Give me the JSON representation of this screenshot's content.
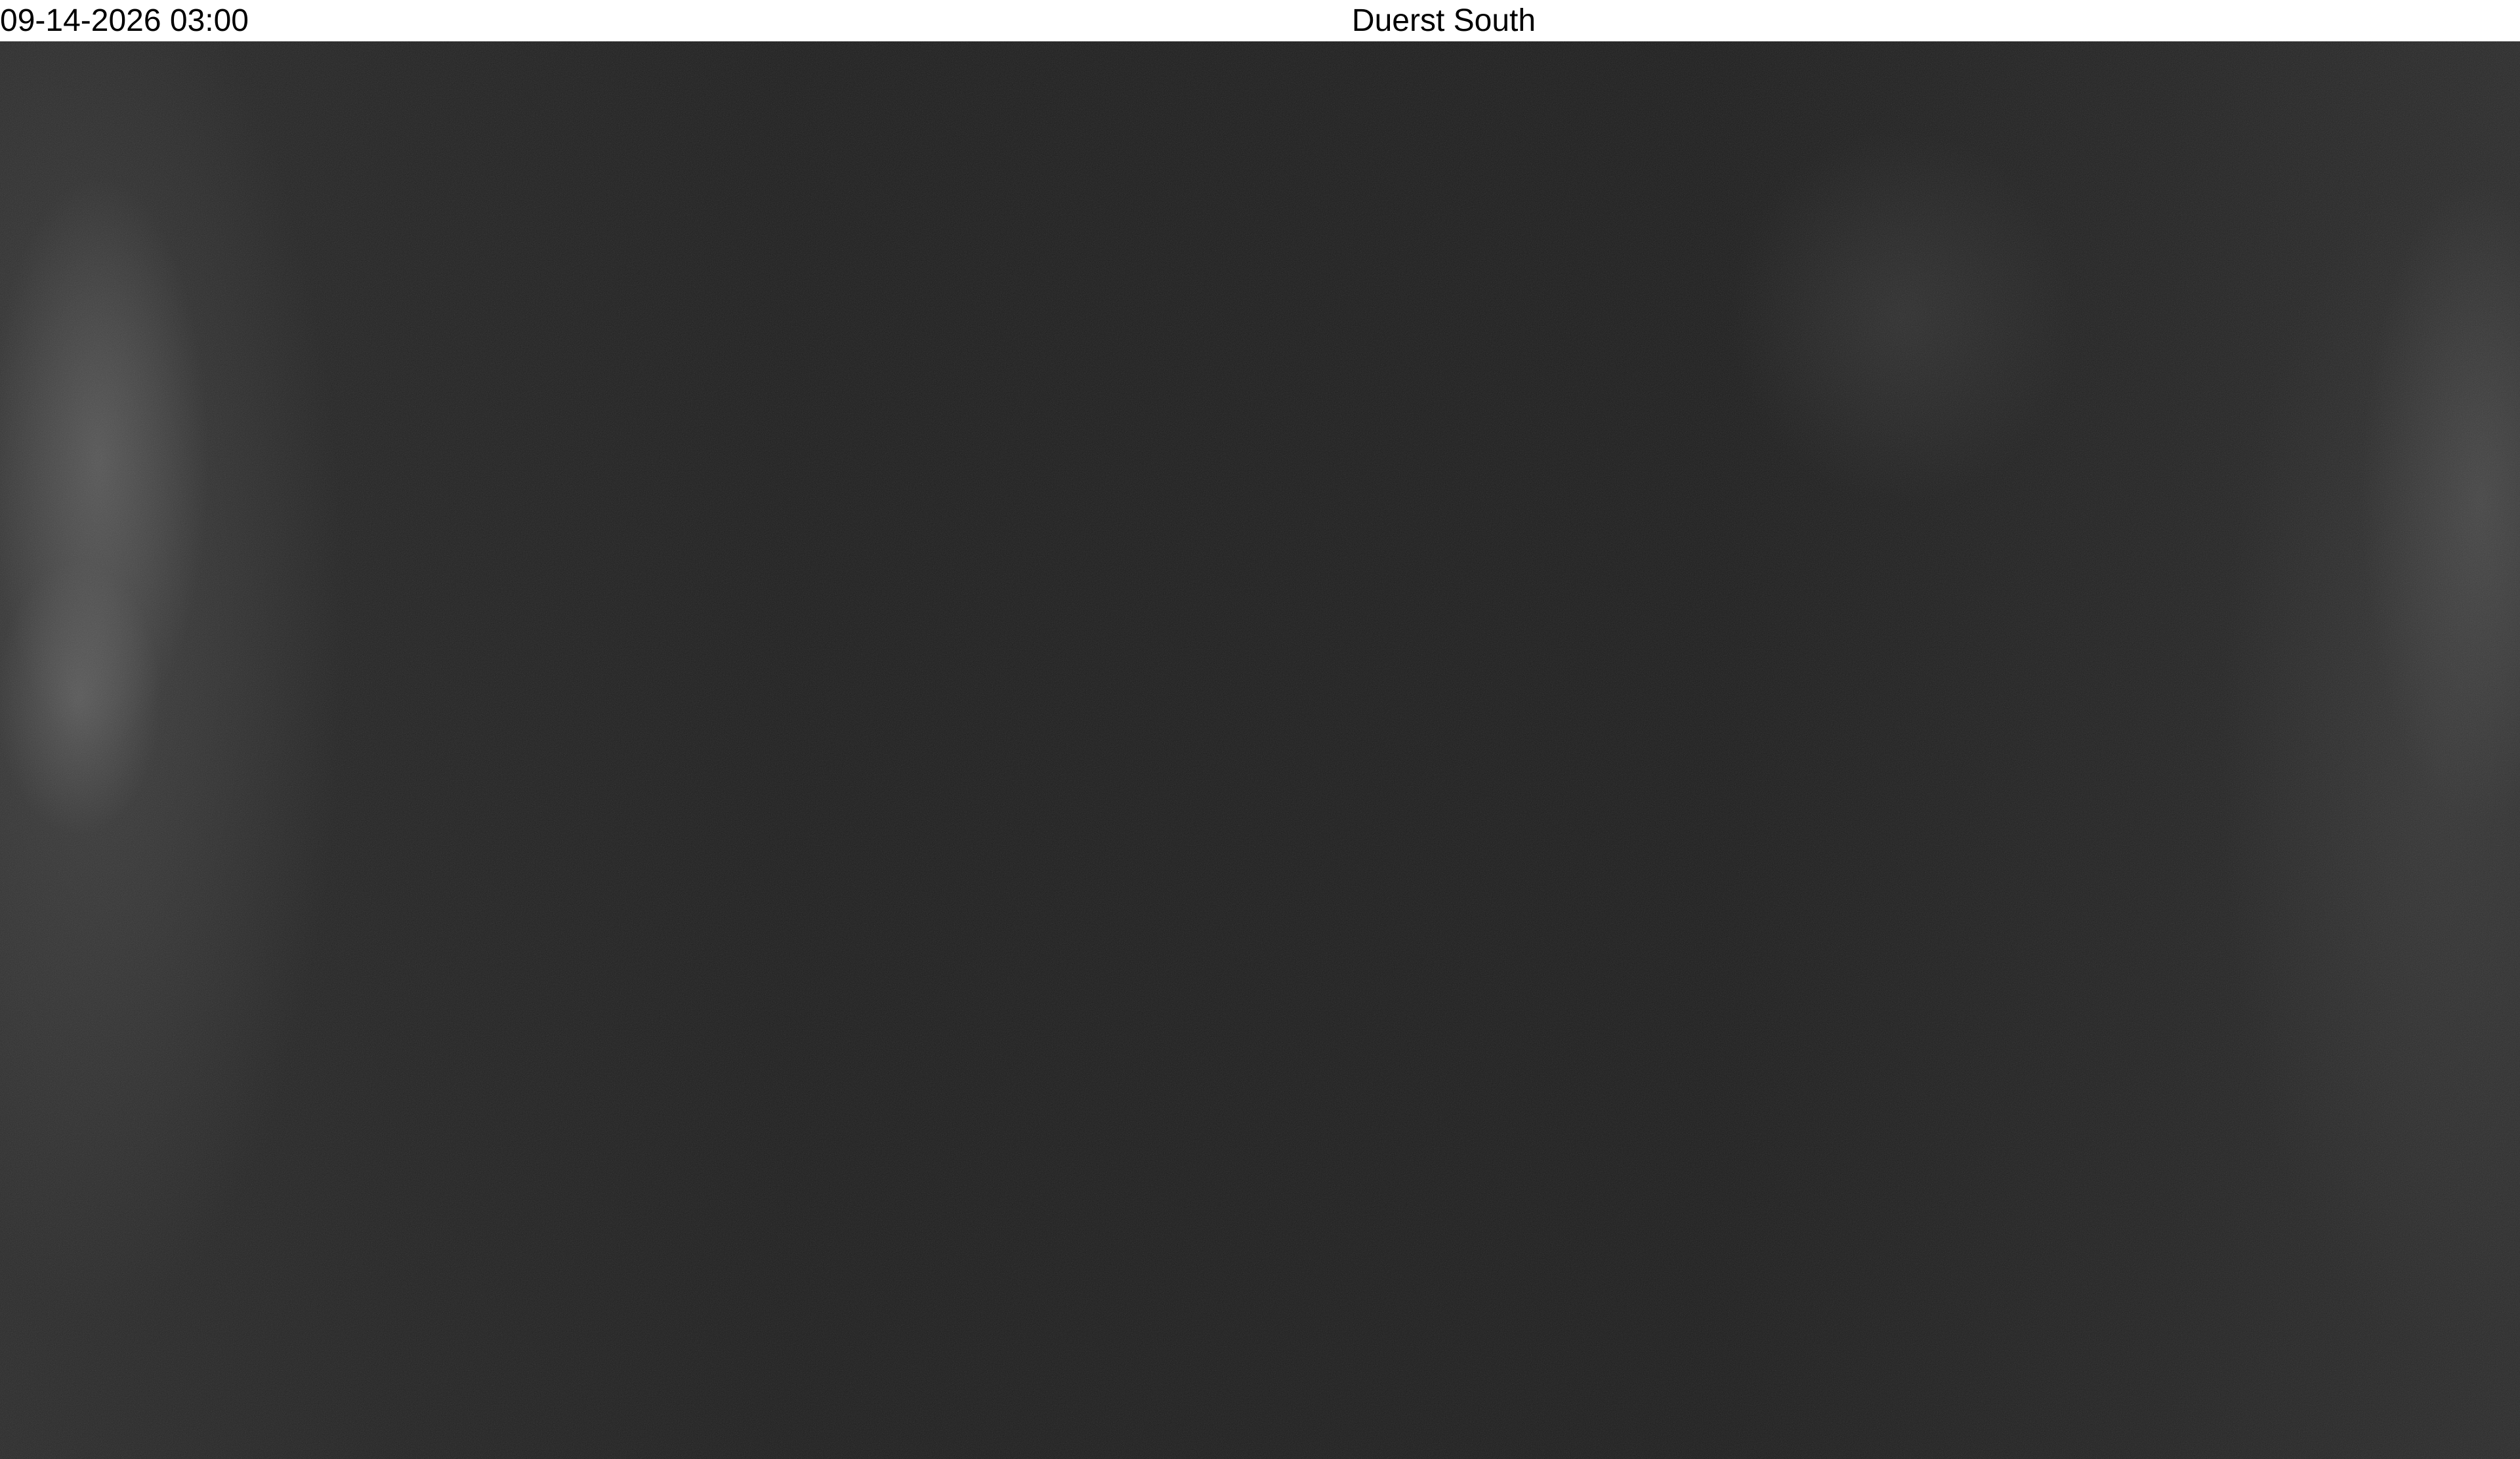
{
  "overlay": {
    "timestamp": "09-14-2026 03:00",
    "camera_name": "Duerst South"
  },
  "colors": {
    "caption_background": "#ffffff",
    "caption_text": "#000000",
    "scene_base": "#1c1c1c"
  }
}
